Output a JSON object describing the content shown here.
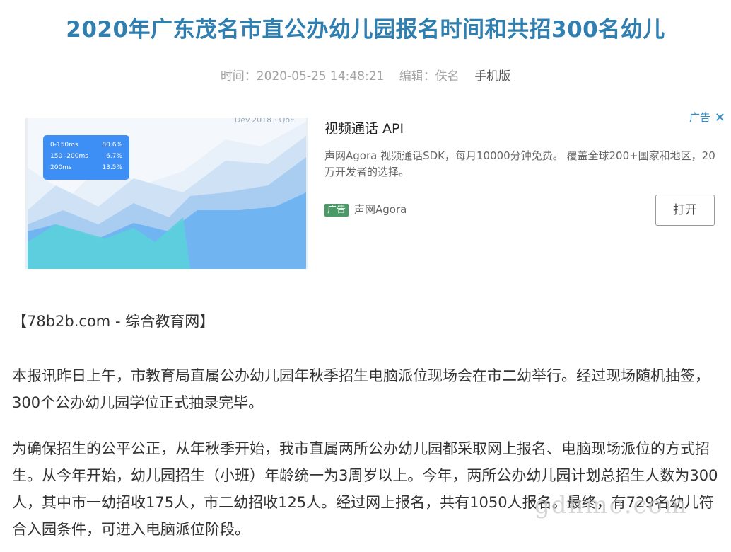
{
  "article": {
    "title": "2020年广东茂名市直公办幼儿园报名时间和共招300名幼儿",
    "meta": {
      "time": "时间：2020-05-25 14:48:21",
      "editor": "编辑：佚名",
      "mobile_link": "手机版"
    },
    "source": "【78b2b.com - 综合教育网】",
    "paragraphs": [
      "本报讯昨日上午，市教育局直属公办幼儿园年秋季招生电脑派位现场会在市二幼举行。经过现场随机抽签，300个公办幼儿园学位正式抽录完毕。",
      "为确保招生的公平公正，从年秋季开始，我市直属两所公办幼儿园都采取网上报名、电脑现场派位的方式招生。从今年开始，幼儿园招生（小班）年龄统一为3周岁以上。今年，两所公办幼儿园计划总招生人数为300人，其中市一幼招收175人，市二幼招收125人。经过网上报名，共有1050人报名。最终，有729名幼儿符合入园条件，可进入电脑派位阶段。"
    ]
  },
  "ad": {
    "label": "广告",
    "close_icon": "✕",
    "title": "视频通话 API",
    "description": "声网Agora 视频通话SDK，每月10000分钟免费。 覆盖全球200+国家和地区，20万开发者的选择。",
    "badge": "广告",
    "advertiser": "声网Agora",
    "open_button": "打开",
    "image": {
      "tag": "Dev.2018 · QoE",
      "latency_rows": [
        {
          "range": "0-150ms",
          "pct": "80.6%"
        },
        {
          "range": "150 -200ms",
          "pct": "6.7%"
        },
        {
          "range": "200ms",
          "pct": "13.5%"
        }
      ]
    }
  },
  "watermark": "gdhmc.com",
  "colors": {
    "title": "#2f7fb0",
    "ad_label": "#2d8fcf",
    "ad_badge": "#4a9966",
    "meta": "#a3a3a3"
  }
}
